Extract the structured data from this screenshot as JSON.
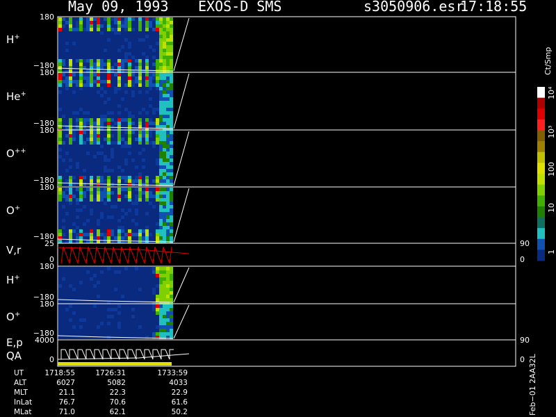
{
  "header": {
    "date": "May 09, 1993",
    "instrument": "EXOS-D SMS",
    "file": "s3050906.esr",
    "time": "17:18:55"
  },
  "panels": [
    {
      "id": "h-plus",
      "label": "H",
      "sup": "+",
      "ytop": "180",
      "ybot": "−180",
      "kind": "spectrogram",
      "type": "full",
      "rlabel": ""
    },
    {
      "id": "he-plus",
      "label": "He",
      "sup": "+",
      "ytop": "180",
      "ybot": "−180",
      "kind": "spectrogram",
      "type": "full",
      "rlabel": ""
    },
    {
      "id": "o-plusplus",
      "label": "O",
      "sup": "++",
      "ytop": "180",
      "ybot": "−180",
      "kind": "spectrogram",
      "type": "full",
      "rlabel": ""
    },
    {
      "id": "o-plus",
      "label": "O",
      "sup": "+",
      "ytop": "180",
      "ybot": "−180",
      "kind": "spectrogram",
      "type": "full",
      "rlabel": ""
    },
    {
      "id": "vr",
      "label": "V,r",
      "sup": "",
      "ytop": "25",
      "ybot": "0",
      "kind": "line",
      "rtop": "90",
      "rbot": "0"
    },
    {
      "id": "h-plus-2",
      "label": "H",
      "sup": "+",
      "ytop": "180",
      "ybot": "−180",
      "kind": "spectrogram",
      "type": "late"
    },
    {
      "id": "o-plus-2",
      "label": "O",
      "sup": "+",
      "ytop": "180",
      "ybot": "−180",
      "kind": "spectrogram",
      "type": "late"
    },
    {
      "id": "ep-qa",
      "label": "E,p",
      "label2": "QA",
      "sup": "",
      "ytop": "4000",
      "ybot": "0",
      "kind": "steps",
      "rtop": "90",
      "rbot": "0"
    }
  ],
  "colorbar": {
    "unit": "Ct/Smp",
    "ticks": [
      "10⁴",
      "10³",
      "100",
      "10",
      "1"
    ],
    "colors": [
      "#ffffff",
      "#b00000",
      "#e00000",
      "#ff2020",
      "#806000",
      "#a08000",
      "#c0c000",
      "#e0e000",
      "#c0e000",
      "#80d000",
      "#40b000",
      "#208000",
      "#107060",
      "#20c0c0",
      "#1050b0",
      "#0a2a80"
    ]
  },
  "orbit": {
    "labels": [
      "UT",
      "ALT",
      "MLT",
      "InLat",
      "MLat"
    ],
    "columns": [
      [
        "1718:55",
        "6027",
        "21.1",
        "76.7",
        "71.0"
      ],
      [
        "1726:31",
        "5082",
        "22.3",
        "70.6",
        "62.1"
      ],
      [
        "1733:59",
        "4033",
        "22.9",
        "61.6",
        "50.2"
      ]
    ]
  },
  "footer": {
    "stamp": "Feb−01 2AA32L"
  },
  "chart_data": {
    "type": "heatmap",
    "title": "May 09, 1993   EXOS-D SMS   s3050906.esr   17:18:55",
    "x_ticks": [
      "1718:55",
      "1726:31",
      "1733:59"
    ],
    "colorbar_label": "Ct/Smp",
    "colorbar_ticks": [
      "1",
      "10",
      "100",
      "10³",
      "10⁴"
    ],
    "series": [
      {
        "name": "H+",
        "yrange": [
          -180,
          180
        ]
      },
      {
        "name": "He+",
        "yrange": [
          -180,
          180
        ]
      },
      {
        "name": "O++",
        "yrange": [
          -180,
          180
        ]
      },
      {
        "name": "O+",
        "yrange": [
          -180,
          180
        ]
      },
      {
        "name": "V,r",
        "yrange": [
          0,
          25
        ],
        "right_range": [
          0,
          90
        ]
      },
      {
        "name": "H+",
        "yrange": [
          -180,
          180
        ]
      },
      {
        "name": "O+",
        "yrange": [
          -180,
          180
        ]
      },
      {
        "name": "E,p",
        "yrange": [
          0,
          4000
        ],
        "right_range": [
          0,
          90
        ]
      }
    ]
  }
}
